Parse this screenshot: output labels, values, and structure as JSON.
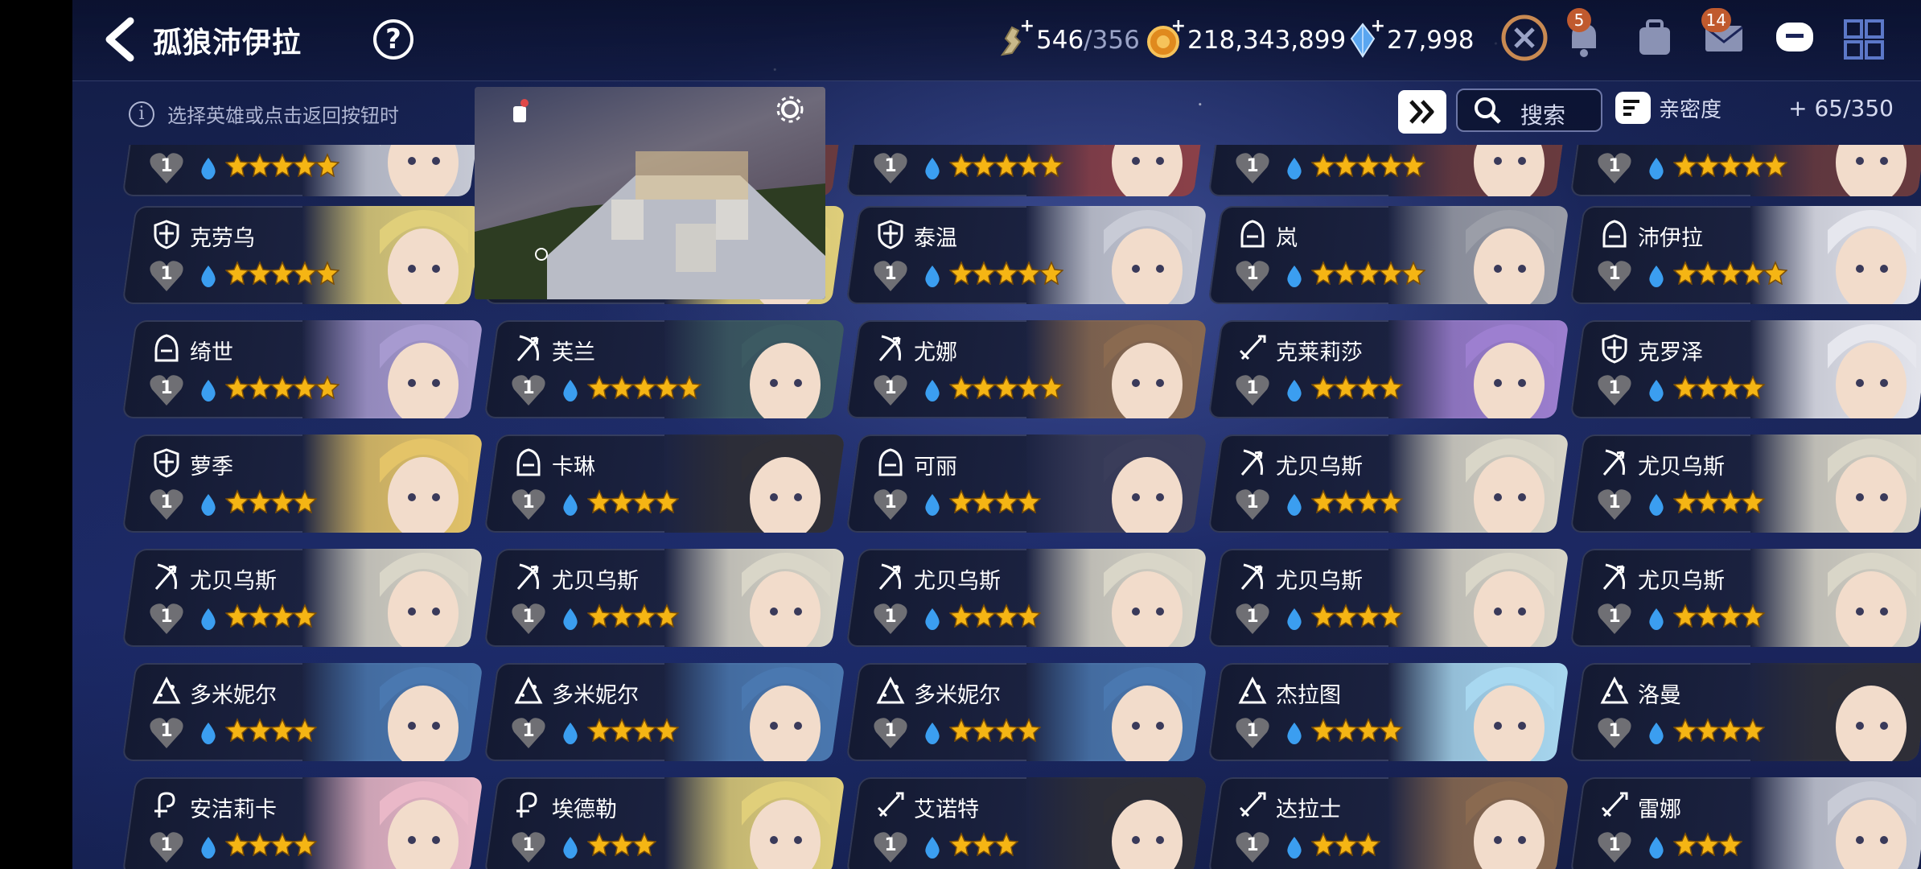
{
  "header": {
    "title": "孤狼沛伊拉",
    "help_label": "?",
    "resources": [
      {
        "icon": "key-icon",
        "value": "546",
        "max": "/356"
      },
      {
        "icon": "gold-coin-icon",
        "value": "218,343,899"
      },
      {
        "icon": "crystal-icon",
        "value": "27,998"
      }
    ],
    "notifications": {
      "alerts": "5",
      "mail": "14"
    }
  },
  "toolbar": {
    "hint": "选择英雄或点击返回按钮时",
    "info_label": "i",
    "search_label": "搜索",
    "filter_label": "亲密度",
    "capacity": "+ 65/350"
  },
  "heroes": [
    {
      "name": "",
      "class": "mage",
      "bond": "1",
      "stars": 5,
      "art": "silver"
    },
    {
      "name": "",
      "class": "archer",
      "bond": "1",
      "stars": 5,
      "art": "dark"
    },
    {
      "name": "",
      "class": "archer",
      "bond": "1",
      "stars": 5,
      "art": "red"
    },
    {
      "name": "",
      "class": "archer",
      "bond": "1",
      "stars": 5,
      "art": "dark"
    },
    {
      "name": "",
      "class": "archer",
      "bond": "1",
      "stars": 5,
      "art": "dark"
    },
    {
      "name": "克劳乌",
      "class": "knight",
      "bond": "1",
      "stars": 5,
      "art": "blond"
    },
    {
      "name": "",
      "class": "knight",
      "bond": "1",
      "stars": 5,
      "art": "blond"
    },
    {
      "name": "泰温",
      "class": "knight",
      "bond": "1",
      "stars": 5,
      "art": "silver"
    },
    {
      "name": "岚",
      "class": "assassin",
      "bond": "1",
      "stars": 5,
      "art": "grey"
    },
    {
      "name": "沛伊拉",
      "class": "assassin",
      "bond": "1",
      "stars": 5,
      "art": "white"
    },
    {
      "name": "绮世",
      "class": "assassin",
      "bond": "1",
      "stars": 5,
      "art": "violet"
    },
    {
      "name": "芙兰",
      "class": "archer",
      "bond": "1",
      "stars": 5,
      "art": "teal"
    },
    {
      "name": "尤娜",
      "class": "archer",
      "bond": "1",
      "stars": 5,
      "art": "brown"
    },
    {
      "name": "克莱莉莎",
      "class": "warrior",
      "bond": "1",
      "stars": 4,
      "art": "purple"
    },
    {
      "name": "克罗泽",
      "class": "knight",
      "bond": "1",
      "stars": 4,
      "art": "white"
    },
    {
      "name": "萝季",
      "class": "knight",
      "bond": "1",
      "stars": 4,
      "art": "gold"
    },
    {
      "name": "卡琳",
      "class": "assassin",
      "bond": "1",
      "stars": 4,
      "art": "black"
    },
    {
      "name": "可丽",
      "class": "assassin",
      "bond": "1",
      "stars": 4,
      "art": "navy"
    },
    {
      "name": "尤贝乌斯",
      "class": "archer",
      "bond": "1",
      "stars": 4,
      "art": "platinum"
    },
    {
      "name": "尤贝乌斯",
      "class": "archer",
      "bond": "1",
      "stars": 4,
      "art": "platinum"
    },
    {
      "name": "尤贝乌斯",
      "class": "archer",
      "bond": "1",
      "stars": 4,
      "art": "platinum"
    },
    {
      "name": "尤贝乌斯",
      "class": "archer",
      "bond": "1",
      "stars": 4,
      "art": "platinum"
    },
    {
      "name": "尤贝乌斯",
      "class": "archer",
      "bond": "1",
      "stars": 4,
      "art": "platinum"
    },
    {
      "name": "尤贝乌斯",
      "class": "archer",
      "bond": "1",
      "stars": 4,
      "art": "platinum"
    },
    {
      "name": "尤贝乌斯",
      "class": "archer",
      "bond": "1",
      "stars": 4,
      "art": "platinum"
    },
    {
      "name": "多米妮尔",
      "class": "mage",
      "bond": "1",
      "stars": 4,
      "art": "blue"
    },
    {
      "name": "多米妮尔",
      "class": "mage",
      "bond": "1",
      "stars": 4,
      "art": "blue"
    },
    {
      "name": "多米妮尔",
      "class": "mage",
      "bond": "1",
      "stars": 4,
      "art": "blue"
    },
    {
      "name": "杰拉图",
      "class": "mage",
      "bond": "1",
      "stars": 4,
      "art": "ice"
    },
    {
      "name": "洛曼",
      "class": "mage",
      "bond": "1",
      "stars": 4,
      "art": "black"
    },
    {
      "name": "安洁莉卡",
      "class": "priest",
      "bond": "1",
      "stars": 4,
      "art": "pink"
    },
    {
      "name": "埃德勒",
      "class": "priest",
      "bond": "1",
      "stars": 3,
      "art": "blond"
    },
    {
      "name": "艾诺特",
      "class": "warrior",
      "bond": "1",
      "stars": 3,
      "art": "black"
    },
    {
      "name": "达拉士",
      "class": "warrior",
      "bond": "1",
      "stars": 3,
      "art": "brown"
    },
    {
      "name": "雷娜",
      "class": "warrior",
      "bond": "1",
      "stars": 3,
      "art": "silver"
    }
  ],
  "palette": {
    "star": "#f5b514",
    "drop": "#3b9ef0",
    "heart": "#6f6f74",
    "accent": "#c05a2e",
    "art": {
      "silver": "#c8cbd6",
      "dark": "#6a3a3e",
      "red": "#8c4048",
      "blond": "#e0cf7a",
      "grey": "#9b9ea8",
      "white": "#e6e7ee",
      "violet": "#a79ad0",
      "teal": "#3c5a62",
      "brown": "#8a6a50",
      "purple": "#9d7fd0",
      "gold": "#e4c468",
      "black": "#2e2e36",
      "navy": "#3a3d5a",
      "platinum": "#d9d6c8",
      "blue": "#4a78b0",
      "ice": "#a8d8f0",
      "pink": "#eab8c8"
    }
  }
}
